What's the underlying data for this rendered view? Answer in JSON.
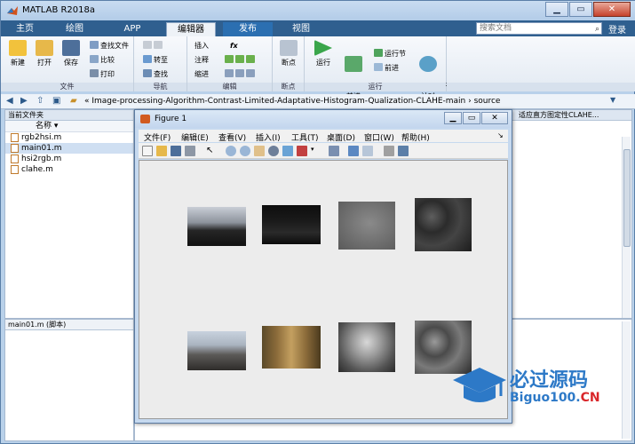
{
  "window": {
    "title": "MATLAB R2018a",
    "minimize": "▁",
    "restore": "▭",
    "close": "✕"
  },
  "tabs": [
    {
      "label": "主页"
    },
    {
      "label": "绘图"
    },
    {
      "label": "APP"
    },
    {
      "label": "编辑器"
    },
    {
      "label": "发布"
    },
    {
      "label": "视图"
    }
  ],
  "search": {
    "placeholder": "搜索文档",
    "login": "登录"
  },
  "ribbon": {
    "file_group": {
      "label": "文件",
      "new": "新建",
      "open": "打开",
      "save": "保存",
      "find_files": "查找文件",
      "compare": "比较",
      "print": "打印"
    },
    "nav_group": {
      "label": "导航",
      "goto": "转至",
      "find": "查找"
    },
    "edit_group": {
      "label": "编辑",
      "insert": "插入",
      "comment": "注释",
      "indent": "缩进",
      "fx": "fx"
    },
    "breakpoint_group": {
      "label": "断点",
      "breakpoints": "断点"
    },
    "run_group": {
      "label": "运行",
      "run": "运行",
      "run_advance": "运行并\n前进",
      "run_section": "运行节",
      "advance": "前进",
      "run_time": "运行并\n计时"
    }
  },
  "address": {
    "path": "« Image-processing-Algorithm-Contrast-Limited-Adaptative-Histogram-Qualization-CLAHE-main  ›  source"
  },
  "current_folder": {
    "title": "当前文件夹",
    "column": "名称 ▾",
    "files": [
      {
        "name": "rgb2hsi.m"
      },
      {
        "name": "main01.m"
      },
      {
        "name": "hsi2rgb.m"
      },
      {
        "name": "clahe.m"
      }
    ],
    "selected_index": 1
  },
  "details": {
    "title": "main01.m  (脚本)"
  },
  "editor_tab": {
    "title": "适应直方图定性CLAHE..."
  },
  "figure": {
    "title": "Figure 1",
    "menu": [
      "文件(F)",
      "编辑(E)",
      "查看(V)",
      "插入(I)",
      "工具(T)",
      "桌面(D)",
      "窗口(W)",
      "帮助(H)"
    ],
    "arrow": "↘"
  },
  "watermark": {
    "cn": "必过源码",
    "en_main": "Biguo100.",
    "en_red": "CN"
  },
  "colors": {
    "accent": "#2f5f8f",
    "figure_bg": "#c6d9ef",
    "brand_blue": "#2d79c7"
  }
}
